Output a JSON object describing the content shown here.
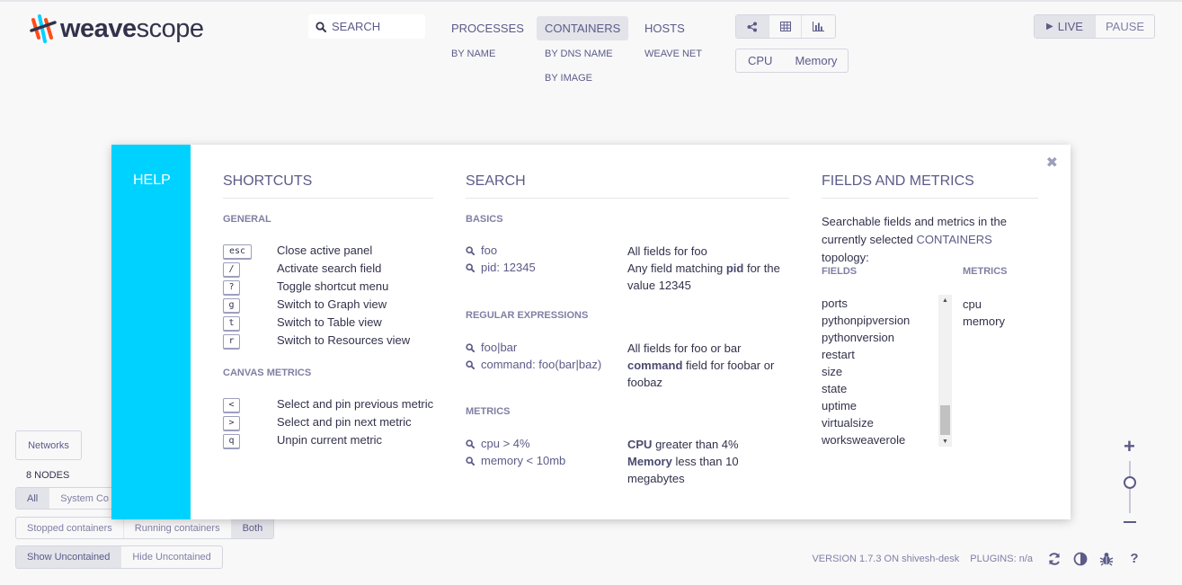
{
  "logo": {
    "part1": "weave",
    "part2": "scope"
  },
  "search": {
    "placeholder": "SEARCH"
  },
  "topologies": {
    "processes": {
      "label": "PROCESSES",
      "subs": [
        "BY NAME"
      ]
    },
    "containers": {
      "label": "CONTAINERS",
      "subs": [
        "BY DNS NAME",
        "BY IMAGE"
      ]
    },
    "hosts": {
      "label": "HOSTS",
      "subs": [
        "WEAVE NET"
      ]
    }
  },
  "view_modes": [
    "graph-icon",
    "table-icon",
    "resources-icon"
  ],
  "metrics_selector": [
    "CPU",
    "Memory"
  ],
  "live_controls": {
    "live": "LIVE",
    "pause": "PAUSE"
  },
  "help": {
    "sidebar_title": "HELP",
    "shortcuts": {
      "title": "SHORTCUTS",
      "general_title": "GENERAL",
      "general": [
        {
          "key": "esc",
          "label": "Close active panel"
        },
        {
          "key": "/",
          "label": "Activate search field"
        },
        {
          "key": "?",
          "label": "Toggle shortcut menu"
        },
        {
          "key": "g",
          "label": "Switch to Graph view"
        },
        {
          "key": "t",
          "label": "Switch to Table view"
        },
        {
          "key": "r",
          "label": "Switch to Resources view"
        }
      ],
      "canvas_title": "CANVAS METRICS",
      "canvas": [
        {
          "key": "<",
          "label": "Select and pin previous metric"
        },
        {
          "key": ">",
          "label": "Select and pin next metric"
        },
        {
          "key": "q",
          "label": "Unpin current metric"
        }
      ]
    },
    "search": {
      "title": "SEARCH",
      "basics_title": "BASICS",
      "basics": [
        {
          "term": "foo",
          "pre": "All fields for foo",
          "bold": "",
          "post": ""
        },
        {
          "term": "pid: 12345",
          "pre": "Any field matching ",
          "bold": "pid",
          "post": " for the value 12345"
        }
      ],
      "regex_title": "REGULAR EXPRESSIONS",
      "regex": [
        {
          "term": "foo|bar",
          "pre": "All fields for foo or bar",
          "bold": "",
          "post": ""
        },
        {
          "term": "command: foo(bar|baz)",
          "pre": "",
          "bold": "command",
          "post": " field for foobar or foobaz"
        }
      ],
      "metrics_title": "METRICS",
      "metrics": [
        {
          "term": "cpu > 4%",
          "pre": "",
          "bold": "CPU",
          "post": " greater than 4%"
        },
        {
          "term": "memory < 10mb",
          "pre": "",
          "bold": "Memory",
          "post": " less than 10 megabytes"
        }
      ]
    },
    "fields_metrics": {
      "title": "FIELDS AND METRICS",
      "intro_pre": "Searchable fields and metrics in the currently selected ",
      "intro_topology": "CONTAINERS",
      "intro_post": " topology:",
      "fields_title": "FIELDS",
      "metrics_title": "METRICS",
      "fields": [
        "ports",
        "pythonpipversion",
        "pythonversion",
        "restart",
        "size",
        "state",
        "uptime",
        "virtualsize",
        "worksweaverole"
      ],
      "metrics": [
        "cpu",
        "memory"
      ]
    }
  },
  "bottom": {
    "networks": "Networks",
    "node_count": "8 NODES",
    "filter1": [
      "All",
      "System Co"
    ],
    "filter2": [
      "Stopped containers",
      "Running containers",
      "Both"
    ],
    "filter3": [
      "Show Uncontained",
      "Hide Uncontained"
    ]
  },
  "footer": {
    "version": "VERSION 1.7.3 ON shivesh-desk",
    "plugins": "PLUGINS: n/a"
  },
  "colors": {
    "accent": "#00d2ff",
    "text": "#5b5b88",
    "dark": "#32324b"
  }
}
